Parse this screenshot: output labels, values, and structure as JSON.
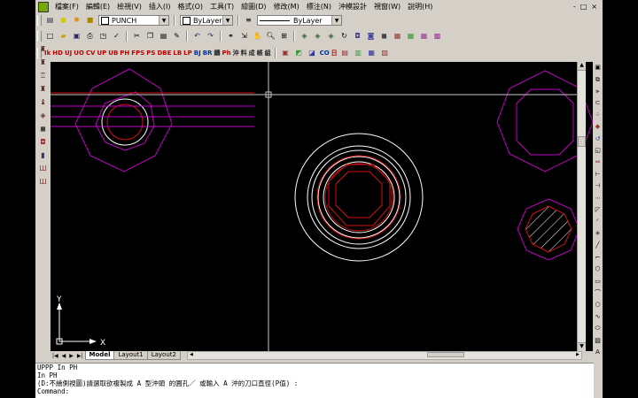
{
  "menubar": {
    "items": [
      "檔案(F)",
      "編輯(E)",
      "檢視(V)",
      "插入(I)",
      "格式(O)",
      "工具(T)",
      "繪圖(D)",
      "修改(M)",
      "標注(N)",
      "沖模設計",
      "視窗(W)",
      "說明(H)"
    ],
    "window_controls": [
      "-",
      "□",
      "×"
    ]
  },
  "layer_toolbar": {
    "layer_value": "PUNCH",
    "color_value": "ByLayer",
    "linetype_value": "ByLayer"
  },
  "punch_toolbar": {
    "items": [
      "Ik",
      "HD",
      "UJ",
      "UO",
      "CV",
      "UP",
      "UB",
      "PH",
      "FPS",
      "PS",
      "DBE",
      "LB",
      "LP",
      "BJ",
      "BR",
      "鑄",
      "Ph",
      "沖",
      "料",
      "成",
      "帳",
      "組",
      "CO",
      "日"
    ]
  },
  "tabs": [
    "Model",
    "Layout1",
    "Layout2"
  ],
  "ucs": {
    "x_label": "X",
    "y_label": "Y"
  },
  "command_lines": [
    "UPPP In PH",
    "  In PH",
    "(D:不繪側視圖)請選取欲複製成  A 型沖頭  的圓孔／  或輸入 A 沖的刀口直徑(P值) :",
    "Command:"
  ],
  "colors": {
    "magenta": "#c000c0",
    "red": "#d01010",
    "white": "#ffffff",
    "crosshair": "#c8c8c8"
  }
}
